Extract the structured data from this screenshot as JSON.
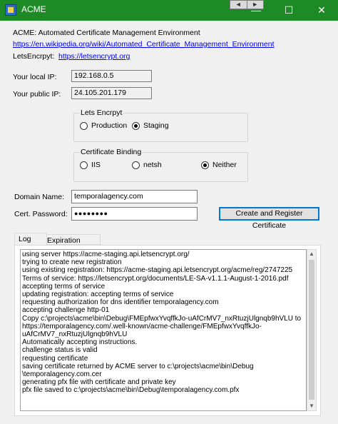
{
  "window": {
    "title": "ACME",
    "nav_back": "◄",
    "nav_forward": "►",
    "minimize": "—",
    "maximize": "☐",
    "close": "✕"
  },
  "header": {
    "description": "ACME: Automated Certificate Management Environment",
    "wiki_link": "https://en.wikipedia.org/wiki/Automated_Certificate_Management_Environment",
    "letsencrypt_label": "LetsEncrpyt:",
    "letsencrypt_link": "https://letsencrypt.org"
  },
  "network": {
    "local_ip_label": "Your local IP:",
    "local_ip": "192.168.0.5",
    "public_ip_label": "Your public IP:",
    "public_ip": "24.105.201.179"
  },
  "lets_encrypt_group": {
    "title": "Lets Encrpyt",
    "options": [
      "Production",
      "Staging"
    ],
    "selected": "Staging"
  },
  "binding_group": {
    "title": "Certificate Binding",
    "options": [
      "IIS",
      "netsh",
      "Neither"
    ],
    "selected": "Neither"
  },
  "form": {
    "domain_label": "Domain Name:",
    "domain_value": "temporalagency.com",
    "password_label": "Cert. Password:",
    "password_value": "●●●●●●●●",
    "create_button": "Create and Register Certificate"
  },
  "tabs": [
    {
      "label": "Log",
      "active": true
    },
    {
      "label": "Expiration Dates",
      "active": false
    }
  ],
  "log_lines": [
    "using server https://acme-staging.api.letsencrypt.org/",
    "trying to create new registration",
    "using existing registration: https://acme-staging.api.letsencrypt.org/acme/reg/2747225",
    "Terms of service: https://letsencrypt.org/documents/LE-SA-v1.1.1-August-1-2016.pdf",
    "accepting terms of service",
    "updating registration: accepting terms of service",
    "requesting authorization for dns identifier temporalagency.com",
    "accepting challenge http-01",
    "Copy c:\\projects\\acme\\bin\\Debug\\FMEpfwxYvqffkJo-uAfCrMV7_nxRtuzjUlgnqb9hVLU to",
    "https://temporalagency.com/.well-known/acme-challenge/FMEpfwxYvqffkJo-",
    "uAfCrMV7_nxRtuzjUlgnqb9hVLU",
    "Automatically accepting instructions.",
    "challenge status is valid",
    "requesting certificate",
    "saving certificate returned by ACME server to c:\\projects\\acme\\bin\\Debug",
    "\\temporalagency.com.cer",
    "generating pfx file with certificate and private key",
    "pfx file saved to c:\\projects\\acme\\bin\\Debug\\temporalagency.com.pfx"
  ],
  "scrollbar": {
    "up": "▲",
    "down": "▼"
  }
}
